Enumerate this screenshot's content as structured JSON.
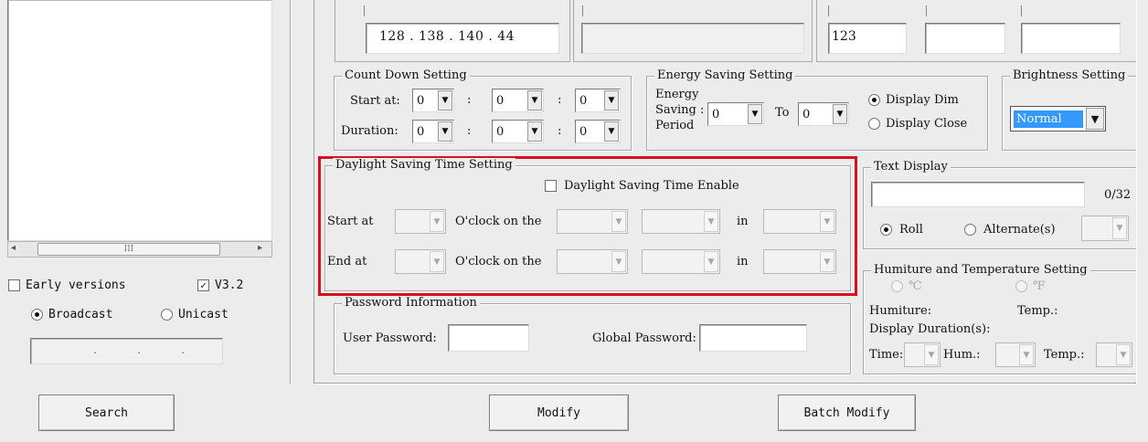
{
  "left_panel": {
    "scroll_left": "◂",
    "scroll_thumb": "III",
    "scroll_right": "▸",
    "early_versions_label": "Early versions",
    "early_versions_checked": false,
    "v32_label": "V3.2",
    "v32_checked": true,
    "v32_check": "✓",
    "broadcast_label": "Broadcast",
    "unicast_label": "Unicast",
    "ip_separators": [
      ".",
      ".",
      "."
    ]
  },
  "network": {
    "ip_value": "128 . 138 . 140 . 44",
    "field_b": "",
    "port_value": "123",
    "field_d": "",
    "field_e": ""
  },
  "countdown": {
    "title": "Count Down Setting",
    "start_label": "Start at:",
    "duration_label": "Duration:",
    "colon": ":",
    "start_values": [
      "0",
      "0",
      "0"
    ],
    "duration_values": [
      "0",
      "0",
      "0"
    ]
  },
  "energy": {
    "title": "Energy Saving Setting",
    "label_line1": "Energy",
    "label_line2": "Saving :",
    "label_line3": "Period",
    "from_value": "0",
    "to_label": "To",
    "to_value": "0",
    "dim_label": "Display Dim",
    "close_label": "Display Close"
  },
  "brightness": {
    "title": "Brightness Setting",
    "value": "Normal"
  },
  "dst": {
    "title": "Daylight Saving Time Setting",
    "enable_label": "Daylight Saving Time Enable",
    "start_label": "Start at",
    "end_label": "End at",
    "oclock_label": "O'clock on the",
    "in_label": "in",
    "highlight_color": "#d6101f"
  },
  "text_display": {
    "title": "Text Display",
    "value": "",
    "counter": "0/32",
    "roll_label": "Roll",
    "alternate_label": "Alternate(s)"
  },
  "password": {
    "title": "Password Information",
    "user_label": "User Password:",
    "global_label": "Global Password:"
  },
  "humiture": {
    "title": "Humiture and Temperature Setting",
    "celsius": "℃",
    "fahrenheit": "℉",
    "humiture_label": "Humiture:",
    "temp_label": "Temp.:",
    "duration_label": "Display Duration(s):",
    "time_label": "Time:",
    "hum_label": "Hum.:",
    "temp2_label": "Temp.:"
  },
  "buttons": {
    "search": "Search",
    "modify": "Modify",
    "batch_modify": "Batch Modify"
  },
  "icons": {
    "dropdown": "▼"
  }
}
